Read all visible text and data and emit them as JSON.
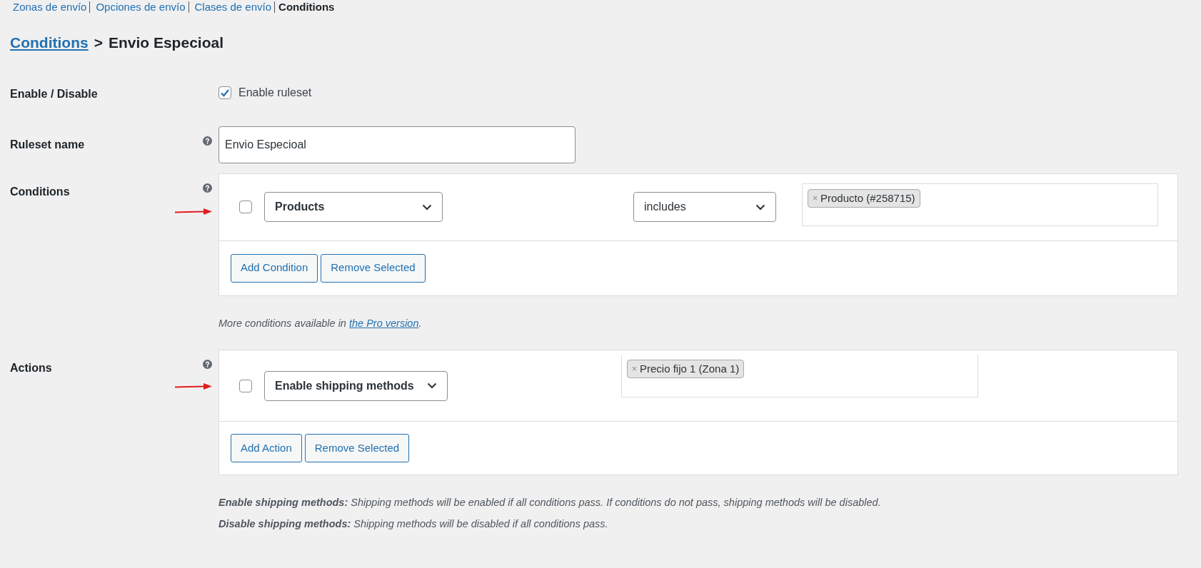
{
  "subnav": [
    {
      "label": "Zonas de envío",
      "selected": false
    },
    {
      "label": "Opciones de envío",
      "selected": false
    },
    {
      "label": "Clases de envío",
      "selected": false
    },
    {
      "label": "Conditions",
      "selected": true
    }
  ],
  "breadcrumb": {
    "link": "Conditions",
    "separator": ">",
    "title": "Envio Especioal"
  },
  "enable": {
    "label": "Enable / Disable",
    "checkbox_label": "Enable ruleset",
    "checked": true
  },
  "ruleset_name": {
    "label": "Ruleset name",
    "value": "Envio Especioal"
  },
  "conditions": {
    "label": "Conditions",
    "rows": [
      {
        "checked": false,
        "type": "Products",
        "operator": "includes",
        "tags": [
          {
            "remove": "×",
            "label": "Producto (#258715)"
          }
        ]
      }
    ],
    "buttons": [
      "Add Condition",
      "Remove Selected"
    ],
    "note": {
      "before": "More conditions available in ",
      "link": "the Pro version",
      "after": "."
    }
  },
  "actions": {
    "label": "Actions",
    "rows": [
      {
        "checked": false,
        "type": "Enable shipping methods",
        "tags": [
          {
            "remove": "×",
            "label": "Precio fijo 1 (Zona 1)"
          }
        ]
      }
    ],
    "buttons": [
      "Add Action",
      "Remove Selected"
    ],
    "notes": [
      "**Enable shipping methods:** Shipping methods will be enabled if all conditions pass. If conditions do not pass, shipping methods will be disabled.",
      "**Disable shipping methods:** Shipping methods will be disabled if all conditions pass."
    ]
  }
}
